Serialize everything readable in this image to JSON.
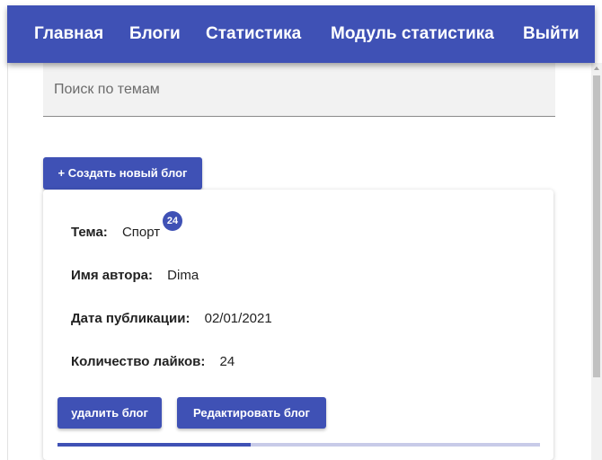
{
  "nav": {
    "items": [
      "Главная",
      "Блоги",
      "Статистика",
      "Модуль статистика",
      "Выйти"
    ]
  },
  "search": {
    "placeholder": "Поиск по темам",
    "value": ""
  },
  "create_button": "+ Создать новый блог",
  "blog": {
    "topic_label": "Тема:",
    "topic": "Спорт",
    "badge": "24",
    "author_label": "Имя автора:",
    "author": "Dima",
    "date_label": "Дата публикации:",
    "date": "02/01/2021",
    "likes_label": "Количество лайков:",
    "likes": "24",
    "delete_button": "удалить блог",
    "edit_button": "Редактировать блог",
    "progress_fraction": 0.4
  },
  "colors": {
    "primary": "#3f51b5",
    "progress_track": "#c8cbe8"
  }
}
